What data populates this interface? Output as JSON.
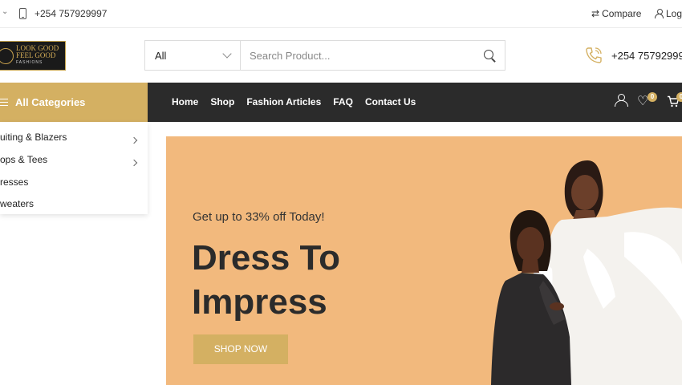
{
  "topbar": {
    "phone": "+254 757929997",
    "compare_label": "Compare",
    "login_label": "Log"
  },
  "brand": {
    "logo_text": [
      "LOOK GOOD",
      "FEEL GOOD",
      "FASHIONS"
    ],
    "accent": "#d4b062",
    "dark": "#2b2b2b",
    "hero_bg": "#f2b97d"
  },
  "search": {
    "category": "All",
    "placeholder": "Search Product..."
  },
  "hotline": "+254 75792999",
  "nav": {
    "all_categories": "All Categories",
    "items": [
      "Home",
      "Shop",
      "Fashion Articles",
      "FAQ",
      "Contact Us"
    ],
    "wishlist_count": "0",
    "cart_count": "0"
  },
  "categories": [
    {
      "label": "uiting & Blazers",
      "has_sub": true
    },
    {
      "label": "ops & Tees",
      "has_sub": true
    },
    {
      "label": "resses",
      "has_sub": false
    },
    {
      "label": "weaters",
      "has_sub": false
    }
  ],
  "hero": {
    "tagline": "Get up to 33% off Today!",
    "headline_line1": "Dress To",
    "headline_line2": "Impress",
    "cta": "SHOP NOW"
  }
}
